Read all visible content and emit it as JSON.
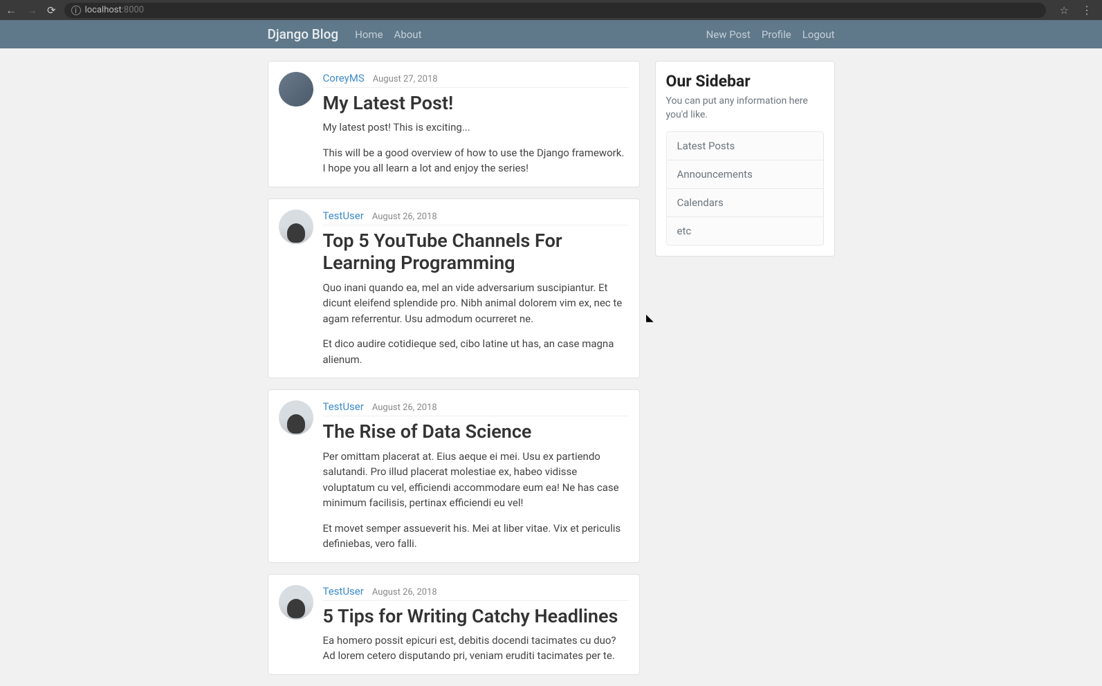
{
  "browser": {
    "url_host": "localhost",
    "url_port": ":8000"
  },
  "nav": {
    "brand": "Django Blog",
    "left": [
      "Home",
      "About"
    ],
    "right": [
      "New Post",
      "Profile",
      "Logout"
    ]
  },
  "posts": [
    {
      "author": "CoreyMS",
      "avatar_class": "corey",
      "date": "August 27, 2018",
      "title": "My Latest Post!",
      "paragraphs": [
        "My latest post! This is exciting...",
        "This will be a good overview of how to use the Django framework. I hope you all learn a lot and enjoy the series!"
      ]
    },
    {
      "author": "TestUser",
      "avatar_class": "",
      "date": "August 26, 2018",
      "title": "Top 5 YouTube Channels For Learning Programming",
      "paragraphs": [
        "Quo inani quando ea, mel an vide adversarium suscipiantur. Et dicunt eleifend splendide pro. Nibh animal dolorem vim ex, nec te agam referrentur. Usu admodum ocurreret ne.",
        "Et dico audire cotidieque sed, cibo latine ut has, an case magna alienum."
      ]
    },
    {
      "author": "TestUser",
      "avatar_class": "",
      "date": "August 26, 2018",
      "title": "The Rise of Data Science",
      "paragraphs": [
        "Per omittam placerat at. Eius aeque ei mei. Usu ex partiendo salutandi. Pro illud placerat molestiae ex, habeo vidisse voluptatum cu vel, efficiendi accommodare eum ea! Ne has case minimum facilisis, pertinax efficiendi eu vel!",
        "Et movet semper assueverit his. Mei at liber vitae. Vix et periculis definiebas, vero falli."
      ]
    },
    {
      "author": "TestUser",
      "avatar_class": "",
      "date": "August 26, 2018",
      "title": "5 Tips for Writing Catchy Headlines",
      "paragraphs": [
        "Ea homero possit epicuri est, debitis docendi tacimates cu duo? Ad lorem cetero disputando pri, veniam eruditi tacimates per te."
      ]
    }
  ],
  "sidebar": {
    "title": "Our Sidebar",
    "desc": "You can put any information here you'd like.",
    "items": [
      "Latest Posts",
      "Announcements",
      "Calendars",
      "etc"
    ]
  }
}
